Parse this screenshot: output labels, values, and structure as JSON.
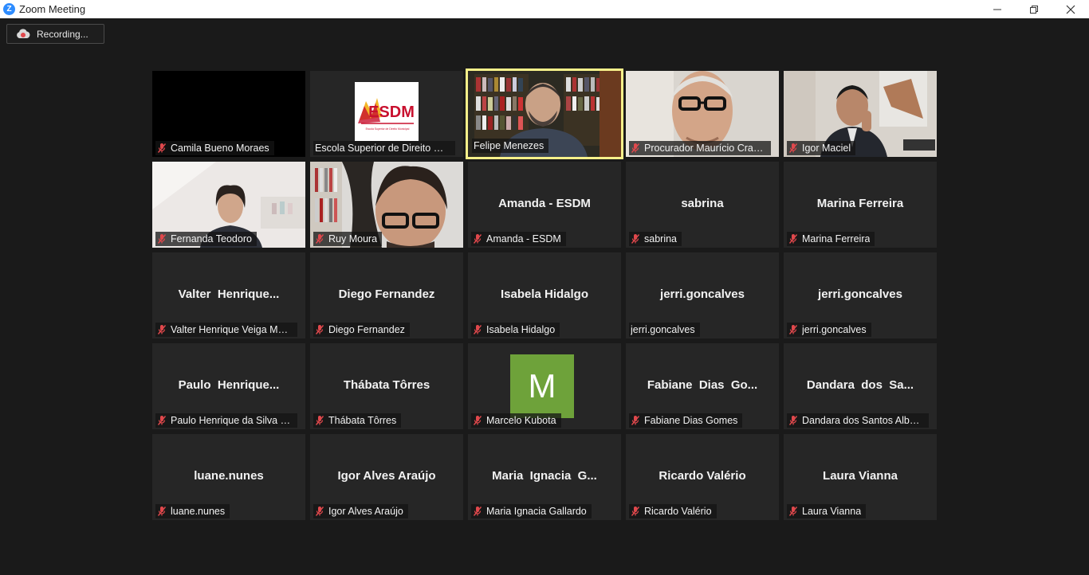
{
  "window": {
    "title": "Zoom Meeting",
    "app_icon": "zoom-icon",
    "controls": [
      "minimize-icon",
      "restore-icon",
      "close-icon"
    ]
  },
  "recording": {
    "label": "Recording...",
    "icon": "cloud-record-icon"
  },
  "colors": {
    "background": "#1a1a1a",
    "tile": "#262626",
    "active_speaker_border": "#f7f08a",
    "muted_mic": "#e0484c",
    "avatar": "#6ea23a",
    "esdm_red": "#c8102e"
  },
  "participants": [
    {
      "name": "Camila Bueno Moraes",
      "center": "",
      "muted": true,
      "video": "black"
    },
    {
      "name": "Escola Superior de Direito Mu...",
      "center": "",
      "muted": false,
      "video": "logo",
      "logo_text": "ESDM",
      "logo_subtext": "Escola Superior de Direito Municipal"
    },
    {
      "name": "Felipe Menezes",
      "center": "",
      "muted": false,
      "video": "camera",
      "active": true
    },
    {
      "name": "Procurador Maurício Cram...",
      "center": "",
      "muted": true,
      "video": "camera"
    },
    {
      "name": "Igor Maciel",
      "center": "",
      "muted": true,
      "video": "camera"
    },
    {
      "name": "Fernanda Teodoro",
      "center": "",
      "muted": true,
      "video": "camera"
    },
    {
      "name": "Ruy Moura",
      "center": "",
      "muted": true,
      "video": "camera"
    },
    {
      "name": "Amanda - ESDM",
      "center": "Amanda - ESDM",
      "muted": true
    },
    {
      "name": "sabrina",
      "center": "sabrina",
      "muted": true
    },
    {
      "name": "Marina Ferreira",
      "center": "Marina Ferreira",
      "muted": true
    },
    {
      "name": "Valter Henrique Veiga Mac...",
      "center": "Valter  Henrique...",
      "muted": true
    },
    {
      "name": "Diego Fernandez",
      "center": "Diego Fernandez",
      "muted": true
    },
    {
      "name": "Isabela Hidalgo",
      "center": "Isabela Hidalgo",
      "muted": true
    },
    {
      "name": "jerri.goncalves",
      "center": "jerri.goncalves",
      "muted": false
    },
    {
      "name": "jerri.goncalves",
      "center": "jerri.goncalves",
      "muted": true
    },
    {
      "name": "Paulo Henrique da Silva Ca...",
      "center": "Paulo  Henrique...",
      "muted": true
    },
    {
      "name": "Thábata Tôrres",
      "center": "Thábata Tôrres",
      "muted": true
    },
    {
      "name": "Marcelo Kubota",
      "center": "",
      "muted": true,
      "avatar_letter": "M"
    },
    {
      "name": "Fabiane Dias Gomes",
      "center": "Fabiane  Dias  Go...",
      "muted": true
    },
    {
      "name": "Dandara dos Santos Albuq...",
      "center": "Dandara  dos  Sa...",
      "muted": true
    },
    {
      "name": "luane.nunes",
      "center": "luane.nunes",
      "muted": true
    },
    {
      "name": "Igor Alves Araújo",
      "center": "Igor Alves Araújo",
      "muted": true
    },
    {
      "name": "Maria Ignacia Gallardo",
      "center": "Maria  Ignacia  G...",
      "muted": true
    },
    {
      "name": "Ricardo Valério",
      "center": "Ricardo Valério",
      "muted": true
    },
    {
      "name": "Laura Vianna",
      "center": "Laura Vianna",
      "muted": true
    }
  ]
}
